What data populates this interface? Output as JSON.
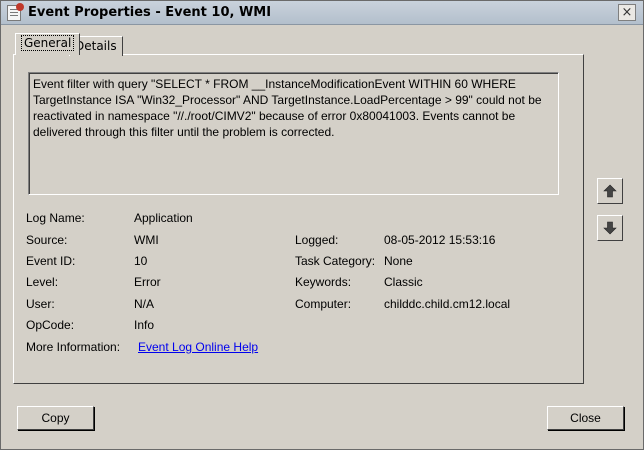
{
  "window": {
    "title": "Event Properties - Event 10, WMI",
    "close_glyph": "×"
  },
  "tabs": [
    {
      "label": "General",
      "active": true
    },
    {
      "label": "Details",
      "active": false
    }
  ],
  "message": "Event filter with query \"SELECT * FROM __InstanceModificationEvent WITHIN 60 WHERE TargetInstance ISA \"Win32_Processor\" AND TargetInstance.LoadPercentage > 99\" could not be reactivated in namespace \"//./root/CIMV2\" because of error 0x80041003. Events cannot be delivered through this filter until the problem is corrected.",
  "fields": {
    "log_name": {
      "label": "Log Name:",
      "value": "Application"
    },
    "source": {
      "label": "Source:",
      "value": "WMI"
    },
    "event_id": {
      "label": "Event ID:",
      "value": "10"
    },
    "level": {
      "label": "Level:",
      "value": "Error"
    },
    "user": {
      "label": "User:",
      "value": "N/A"
    },
    "opcode": {
      "label": "OpCode:",
      "value": "Info"
    },
    "more_info": {
      "label": "More Information:",
      "link": "Event Log Online Help"
    },
    "logged": {
      "label": "Logged:",
      "value": "08-05-2012 15:53:16"
    },
    "task_category": {
      "label": "Task Category:",
      "value": "None"
    },
    "keywords": {
      "label": "Keywords:",
      "value": "Classic"
    },
    "computer": {
      "label": "Computer:",
      "value": "childdc.child.cm12.local"
    }
  },
  "buttons": {
    "copy": "Copy",
    "close": "Close"
  },
  "icons": {
    "up": "arrow-up-icon",
    "down": "arrow-down-icon"
  }
}
